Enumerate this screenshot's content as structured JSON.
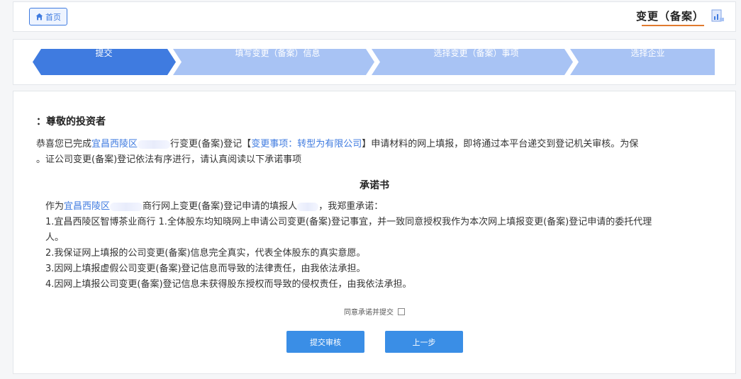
{
  "header": {
    "home_label": "首页",
    "title": "变更（备案）",
    "home_icon": "home-icon",
    "title_icon": "document-chart-icon"
  },
  "steps": [
    {
      "label": "选择企业",
      "active": false
    },
    {
      "label": "选择变更（备案）事项",
      "active": false
    },
    {
      "label": "填写变更（备案）信息",
      "active": false
    },
    {
      "label": "提交",
      "active": true
    }
  ],
  "colors": {
    "active_step": "#3f7be0",
    "inactive_step": "#a8c3f4",
    "button": "#3a8ee6",
    "accent_underline": "#e07a2e"
  },
  "notice": {
    "salutation": "尊敬的投资者：",
    "p1_prefix": "恭喜您已完成",
    "p1_company": "宜昌西陵区",
    "p1_company_suffix": "行变更(备案)登记【",
    "p1_matter": "变更事项：转型为有限公司",
    "p1_rest": "】申请材料的网上填报，即将通过本平台递交到登记机关审核。为保",
    "p2": "证公司变更(备案)登记依法有序进行，请认真阅读以下承诺事项。"
  },
  "commitment": {
    "title": "承诺书",
    "intro_prefix": "作为",
    "intro_company": "宜昌西陵区",
    "intro_mid": "商行网上变更(备案)登记申请的填报人",
    "intro_suffix": "，我郑重承诺：",
    "items": [
      "1.宜昌西陵区智博茶业商行 1.全体股东均知晓网上申请公司变更(备案)登记事宜，并一致同意授权我作为本次网上填报变更(备案)登记申请的委托代理",
      "人。",
      "2.我保证网上填报的公司变更(备案)信息完全真实，代表全体股东的真实意愿。",
      "3.因网上填报虚假公司变更(备案)登记信息而导致的法律责任，由我依法承担。",
      "4.因网上填报公司变更(备案)登记信息未获得股东授权而导致的侵权责任，由我依法承担。"
    ]
  },
  "form": {
    "agree_label": "同意承诺并提交",
    "agree_checked": false,
    "prev_label": "上一步",
    "submit_label": "提交审核"
  }
}
